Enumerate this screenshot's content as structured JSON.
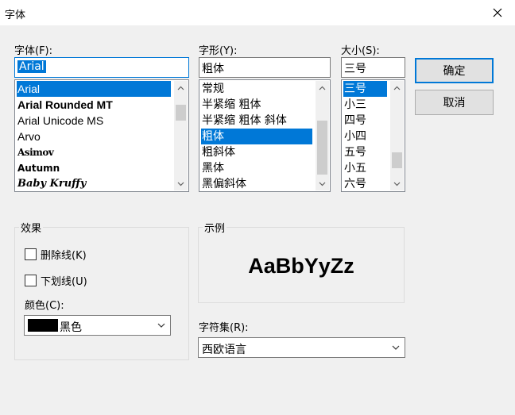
{
  "window": {
    "title": "字体",
    "close_icon": "close-icon"
  },
  "font": {
    "label": "字体(F):",
    "value": "Arial",
    "items": [
      "Arial",
      "Arial Rounded MT",
      "Arial Unicode MS",
      "Arvo",
      "Asimov",
      "Autumn",
      "Baby Kruffy"
    ],
    "selected_index": 0
  },
  "style": {
    "label": "字形(Y):",
    "value": "粗体",
    "items": [
      "常规",
      "半紧缩 粗体",
      "半紧缩 粗体 斜体",
      "粗体",
      "粗斜体",
      "黑体",
      "黑偏斜体"
    ],
    "selected_index": 3
  },
  "size": {
    "label": "大小(S):",
    "value": "三号",
    "items": [
      "三号",
      "小三",
      "四号",
      "小四",
      "五号",
      "小五",
      "六号"
    ],
    "selected_index": 0
  },
  "buttons": {
    "ok": "确定",
    "cancel": "取消"
  },
  "effects": {
    "label": "效果",
    "strikeout": {
      "label": "删除线(K)",
      "checked": false
    },
    "underline": {
      "label": "下划线(U)",
      "checked": false
    },
    "color_label": "颜色(C):",
    "color_value": "黑色",
    "color_swatch": "#000000"
  },
  "sample": {
    "label": "示例",
    "text": "AaBbYyZz"
  },
  "charset": {
    "label": "字符集(R):",
    "value": "西欧语言"
  },
  "colors": {
    "accent": "#0078d7",
    "background": "#f0f0f0"
  }
}
